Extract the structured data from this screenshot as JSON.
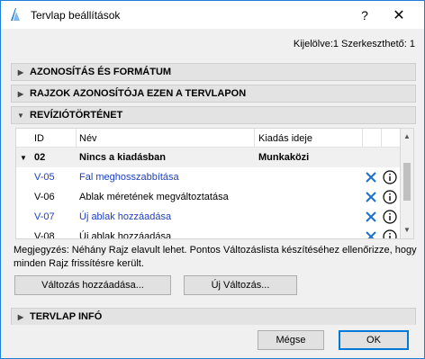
{
  "window": {
    "title": "Tervlap beállítások",
    "help_label": "?",
    "close_label": "✕"
  },
  "selection_info": "Kijelölve:1 Szerkeszthető: 1",
  "sections": {
    "identification": "AZONOSÍTÁS ÉS FORMÁTUM",
    "drawings_id": "RAJZOK AZONOSÍTÓJA EZEN A TERVLAPON",
    "revision_history": "REVÍZIÓTÖRTÉNET",
    "sheet_info": "TERVLAP INFÓ"
  },
  "table": {
    "headers": {
      "id": "ID",
      "name": "Név",
      "issue_date": "Kiadás ideje"
    },
    "group": {
      "id": "02",
      "name": "Nincs a kiadásban",
      "issue_date": "Munkaközi"
    },
    "rows": [
      {
        "id": "V-05",
        "name": "Fal meghosszabbítása",
        "highlight": true
      },
      {
        "id": "V-06",
        "name": "Ablak méretének megváltoztatása",
        "highlight": false
      },
      {
        "id": "V-07",
        "name": "Új ablak hozzáadása",
        "highlight": true
      },
      {
        "id": "V-08",
        "name": "Új ablak hozzáadása",
        "highlight": false
      }
    ]
  },
  "note": "Megjegyzés: Néhány Rajz elavult lehet. Pontos Változáslista készítéséhez ellenőrizze, hogy minden Rajz frissítésre került.",
  "buttons": {
    "add_change": "Változás hozzáadása...",
    "new_change": "Új Változás...",
    "cancel": "Mégse",
    "ok": "OK"
  },
  "colors": {
    "link_blue": "#1d3fc0",
    "accent": "#0078d7",
    "section_bg": "#e3e3e3"
  }
}
